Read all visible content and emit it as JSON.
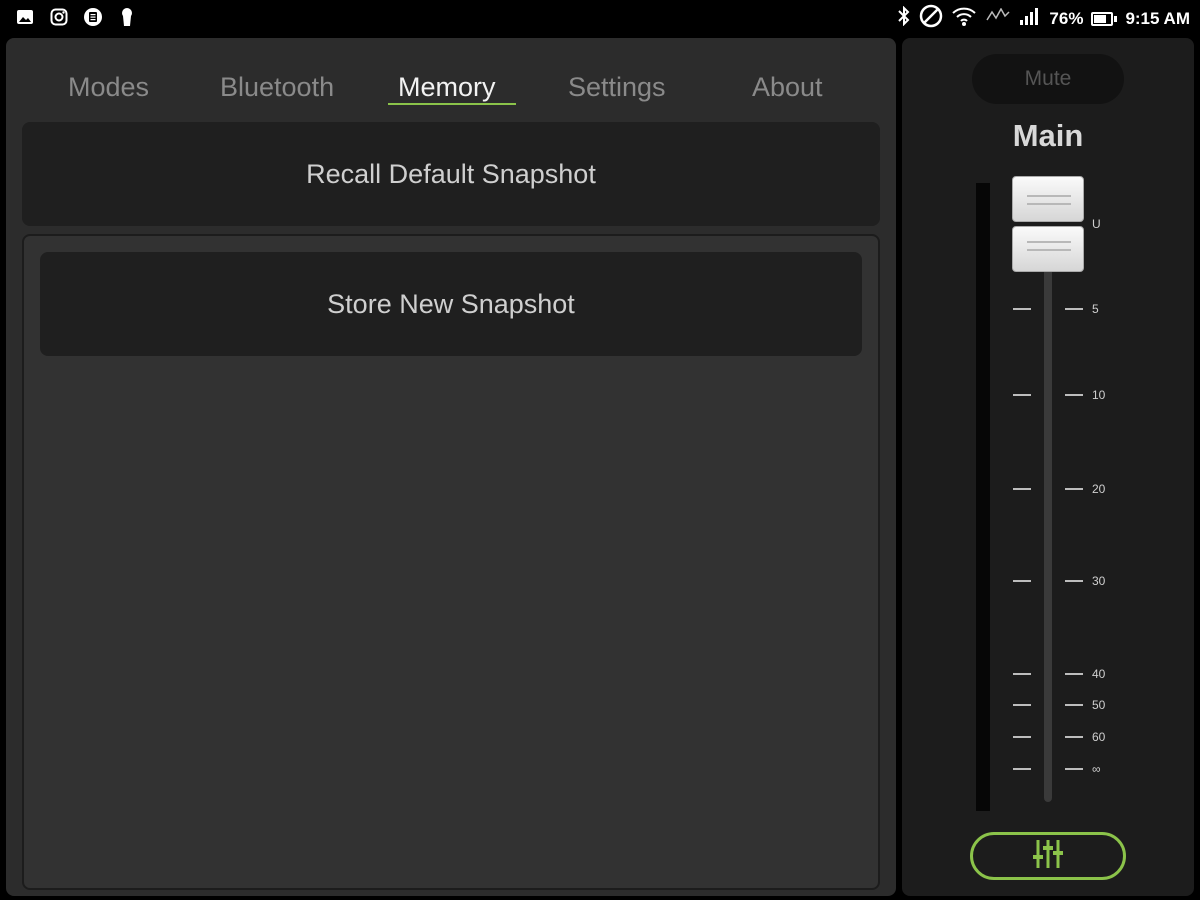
{
  "status_bar": {
    "left_icons": [
      "image-icon",
      "instagram-icon",
      "app-icon",
      "keyhole-icon"
    ],
    "right_icons": [
      "bluetooth-icon",
      "do-not-disturb-icon",
      "wifi-icon",
      "network-icon",
      "signal-icon"
    ],
    "battery": "76%",
    "battery_level": 0.76,
    "time": "9:15 AM"
  },
  "tabs": [
    {
      "label": "Modes",
      "active": false
    },
    {
      "label": "Bluetooth",
      "active": false
    },
    {
      "label": "Memory",
      "active": true
    },
    {
      "label": "Settings",
      "active": false
    },
    {
      "label": "About",
      "active": false
    }
  ],
  "memory": {
    "recall_label": "Recall Default Snapshot",
    "store_label": "Store New Snapshot"
  },
  "fader": {
    "mute_label": "Mute",
    "channel_name": "Main",
    "scale_labels": [
      "U",
      "5",
      "10",
      "20",
      "30",
      "40",
      "50",
      "60",
      "∞"
    ],
    "meter_level": 0,
    "mixer_button_icon": "faders-icon"
  },
  "colors": {
    "accent": "#8bc34a",
    "panel": "#2c2c2c",
    "button": "#1f1f1f"
  }
}
